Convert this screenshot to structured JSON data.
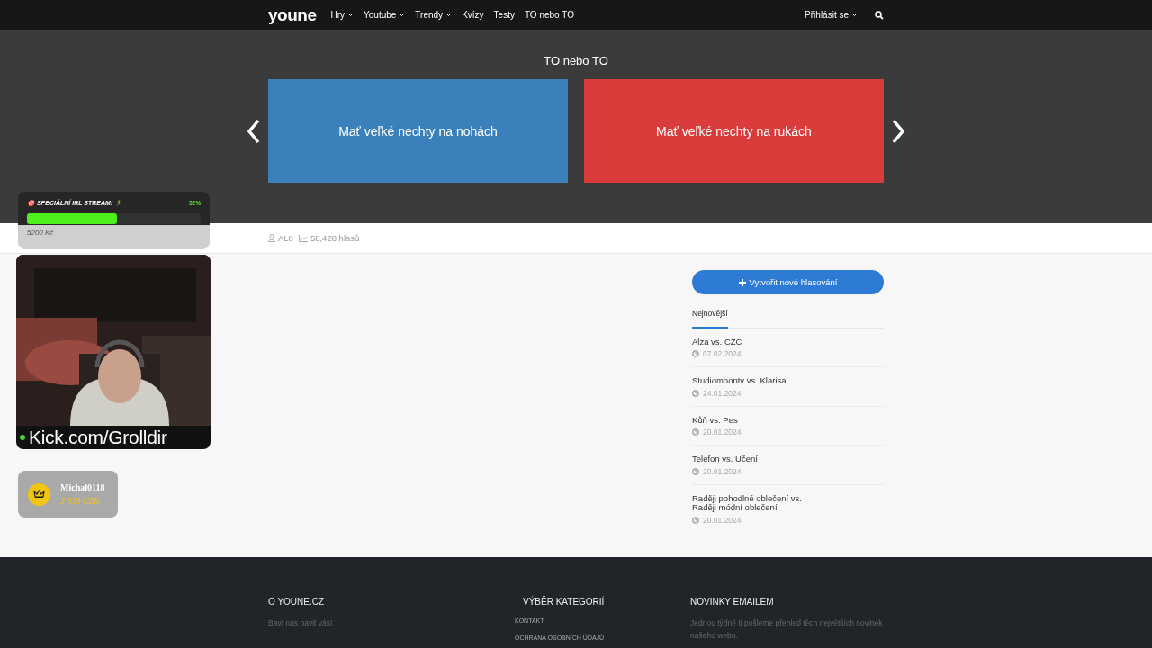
{
  "navbar": {
    "logo": "youne",
    "items": [
      {
        "label": "Hry",
        "dropdown": true
      },
      {
        "label": "Youtube",
        "dropdown": true
      },
      {
        "label": "Trendy",
        "dropdown": true
      },
      {
        "label": "Kvízy",
        "dropdown": false
      },
      {
        "label": "Testy",
        "dropdown": false
      },
      {
        "label": "TO nebo TO",
        "dropdown": false
      }
    ],
    "login": "Přihlásit se"
  },
  "hero": {
    "title": "TO nebo TO",
    "options": [
      {
        "label": "Mať veľké nechty na nohách",
        "color": "#3a80bb"
      },
      {
        "label": "Mať veľké nechty na rukách",
        "color": "#d93c3a"
      }
    ]
  },
  "stats": {
    "author": "AL8",
    "votes": "58,428 hlasů"
  },
  "sidebar": {
    "create_button": "Vytvořit nové hlasování",
    "tabs": [
      {
        "label": "Nejnovější",
        "selected": true
      }
    ],
    "items": [
      {
        "title": "Alza vs. CZC",
        "date": "07.02.2024"
      },
      {
        "title": "Studiomoontv vs. Klarisa",
        "date": "24.01.2024"
      },
      {
        "title": "Kůň vs. Pes",
        "date": "20.01.2024"
      },
      {
        "title": "Telefon vs. Učení",
        "date": "20.01.2024"
      },
      {
        "title": "Raději pohodlné oblečení vs. Raději módní oblečení",
        "date": "20.01.2024"
      }
    ]
  },
  "footer": {
    "columns": [
      {
        "heading": "O YOUNE.CZ",
        "texts": [
          "Baví nás bavit vás!"
        ]
      },
      {
        "heading": "VÝBĚR KATEGORIÍ",
        "links": [
          "KONTAKT",
          "OCHRANA OSOBNÍCH ÚDAJŮ"
        ]
      },
      {
        "heading": "NOVINKY EMAILEM",
        "texts": [
          "Jednou týdně ti pošleme přehled těch největších novinek našeho webu."
        ]
      }
    ]
  },
  "overlay": {
    "goal": {
      "title": "🎯 SPECIÁLNÍ IRL STREAM! 🏃",
      "percent": "52%",
      "level": 0.52,
      "amount": "5200 Kč"
    },
    "webcam": {
      "kind": "picture",
      "caption": "Kick.com/Grolldir"
    },
    "donation": {
      "name": "Michal0118",
      "amount": "3 939 CZK"
    }
  }
}
